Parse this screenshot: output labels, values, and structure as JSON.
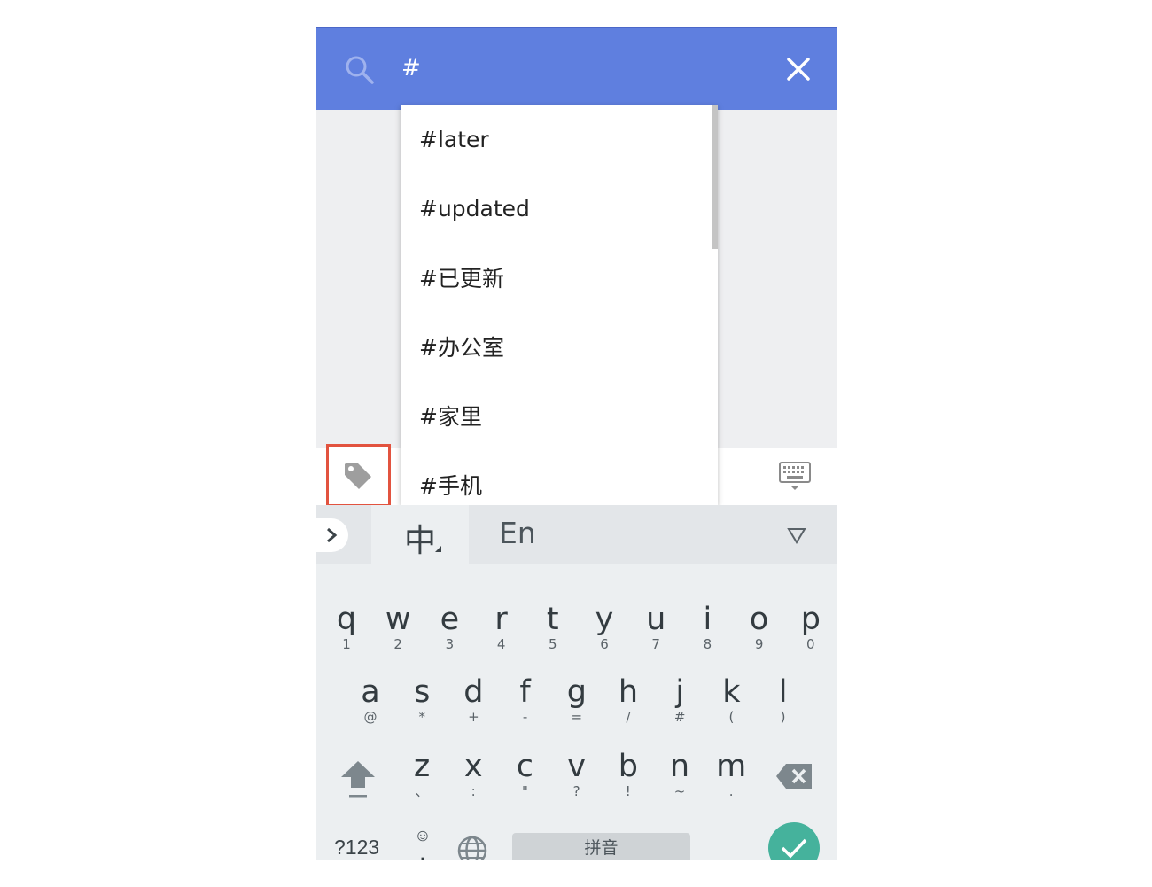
{
  "search": {
    "query": "#",
    "icon": "search-icon",
    "clear_icon": "close-icon"
  },
  "tag_suggestions": [
    "#later",
    "#updated",
    "#已更新",
    "#办公室",
    "#家里",
    "#手机"
  ],
  "toolbar": {
    "tag_icon": "tag-icon",
    "hide_keyboard_icon": "keyboard-hide-icon"
  },
  "keyboard": {
    "mode_zh": "中",
    "mode_en": "En",
    "rows": [
      [
        {
          "main": "q",
          "sub": "1"
        },
        {
          "main": "w",
          "sub": "2"
        },
        {
          "main": "e",
          "sub": "3"
        },
        {
          "main": "r",
          "sub": "4"
        },
        {
          "main": "t",
          "sub": "5"
        },
        {
          "main": "y",
          "sub": "6"
        },
        {
          "main": "u",
          "sub": "7"
        },
        {
          "main": "i",
          "sub": "8"
        },
        {
          "main": "o",
          "sub": "9"
        },
        {
          "main": "p",
          "sub": "0"
        }
      ],
      [
        {
          "main": "a",
          "sub": "@"
        },
        {
          "main": "s",
          "sub": "*"
        },
        {
          "main": "d",
          "sub": "+"
        },
        {
          "main": "f",
          "sub": "-"
        },
        {
          "main": "g",
          "sub": "="
        },
        {
          "main": "h",
          "sub": "/"
        },
        {
          "main": "j",
          "sub": "#"
        },
        {
          "main": "k",
          "sub": "("
        },
        {
          "main": "l",
          "sub": ")"
        }
      ],
      [
        {
          "main": "z",
          "sub": "、"
        },
        {
          "main": "x",
          "sub": ":"
        },
        {
          "main": "c",
          "sub": "\""
        },
        {
          "main": "v",
          "sub": "?"
        },
        {
          "main": "b",
          "sub": "!"
        },
        {
          "main": "n",
          "sub": "~"
        },
        {
          "main": "m",
          "sub": "."
        }
      ]
    ],
    "symbols_label": "?123",
    "emoji_label": "☺",
    "comma_label": ",",
    "space_label": "拼音",
    "period_label": "。"
  },
  "colors": {
    "header": "#5f7fdf",
    "highlight_border": "#e2533f",
    "enter": "#45b29c"
  }
}
